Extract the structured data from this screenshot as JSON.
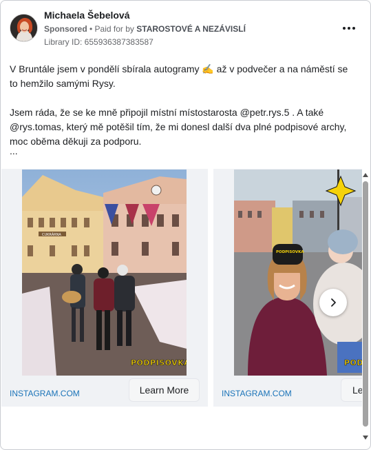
{
  "post": {
    "author": "Michaela Šebelová",
    "sponsored_label": "Sponsored",
    "paid_for_prefix": " • Paid for by ",
    "payer": "STAROSTOVÉ A NEZÁVISLÍ",
    "library_id": "Library ID: 655936387383587",
    "more_icon": "more-horizontal-icon",
    "text_line1": "V Bruntále jsem v pondělí sbírala autogramy ✍ až v podvečer a na náměstí se to hemžilo samými Rysy.",
    "text_line2": "Jsem ráda, že se ke mně připojil místní místostarosta @petr.rys.5 . A také @rys.tomas, který mě potěšil tím, že mi donesl další dva plné podpisové archy, moc oběma děkuji za podporu.",
    "ellipsis": "..."
  },
  "carousel": {
    "cards": [
      {
        "domain": "INSTAGRAM.COM",
        "cta": "Learn More",
        "image_text_sign": "CUKRÁRNA",
        "image_text_badge": "PODPISOVKA"
      },
      {
        "domain": "INSTAGRAM.COM",
        "cta": "Le",
        "image_text_hat": "PODPISOVKA",
        "image_text_badge": "PODPISOVKA"
      }
    ],
    "next_icon": "chevron-right-icon"
  },
  "colors": {
    "link": "#1a73b8",
    "badge_yellow": "#f5d20a",
    "text_primary": "#1c1e21",
    "text_secondary": "#65676b"
  }
}
